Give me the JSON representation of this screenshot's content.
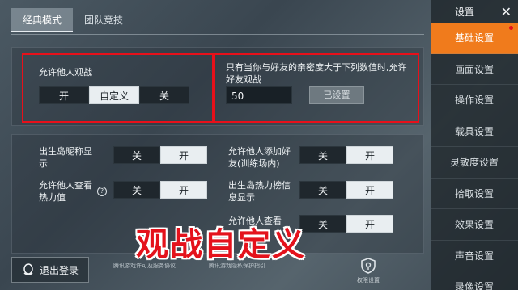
{
  "tabs": [
    {
      "label": "经典模式"
    },
    {
      "label": "团队竞技"
    }
  ],
  "spectate": {
    "label": "允许他人观战",
    "options": [
      "开",
      "自定义",
      "关"
    ],
    "selected": "自定义",
    "intimacy_label": "只有当你与好友的亲密度大于下列数值时,允许好友观战",
    "intimacy_value": "50",
    "set_button": "已设置"
  },
  "settings": [
    {
      "label": "出生岛昵称显示",
      "options": [
        "关",
        "开"
      ],
      "selected": "开"
    },
    {
      "label": "允许他人添加好友(训练场内)",
      "options": [
        "关",
        "开"
      ],
      "selected": "开"
    },
    {
      "label": "允许他人查看热力值",
      "options": [
        "关",
        "开"
      ],
      "selected": "开"
    },
    {
      "label": "出生岛热力榜信息显示",
      "options": [
        "关",
        "开"
      ],
      "selected": "开"
    },
    {
      "label": "允许他人查看",
      "options": [
        "关",
        "开"
      ],
      "selected": "开"
    }
  ],
  "overlay_caption": "观战自定义",
  "logout_label": "退出登录",
  "footer_links": [
    "腾讯游戏许可及服务协议",
    "腾讯游戏隐私保护指引"
  ],
  "permission_label": "权限设置",
  "sidebar": {
    "title": "设置",
    "items": [
      "基础设置",
      "画面设置",
      "操作设置",
      "载具设置",
      "灵敏度设置",
      "拾取设置",
      "效果设置",
      "声音设置",
      "录像设置"
    ],
    "active": "基础设置"
  },
  "colors": {
    "accent": "#f07b1c",
    "highlight": "#e4121c"
  }
}
